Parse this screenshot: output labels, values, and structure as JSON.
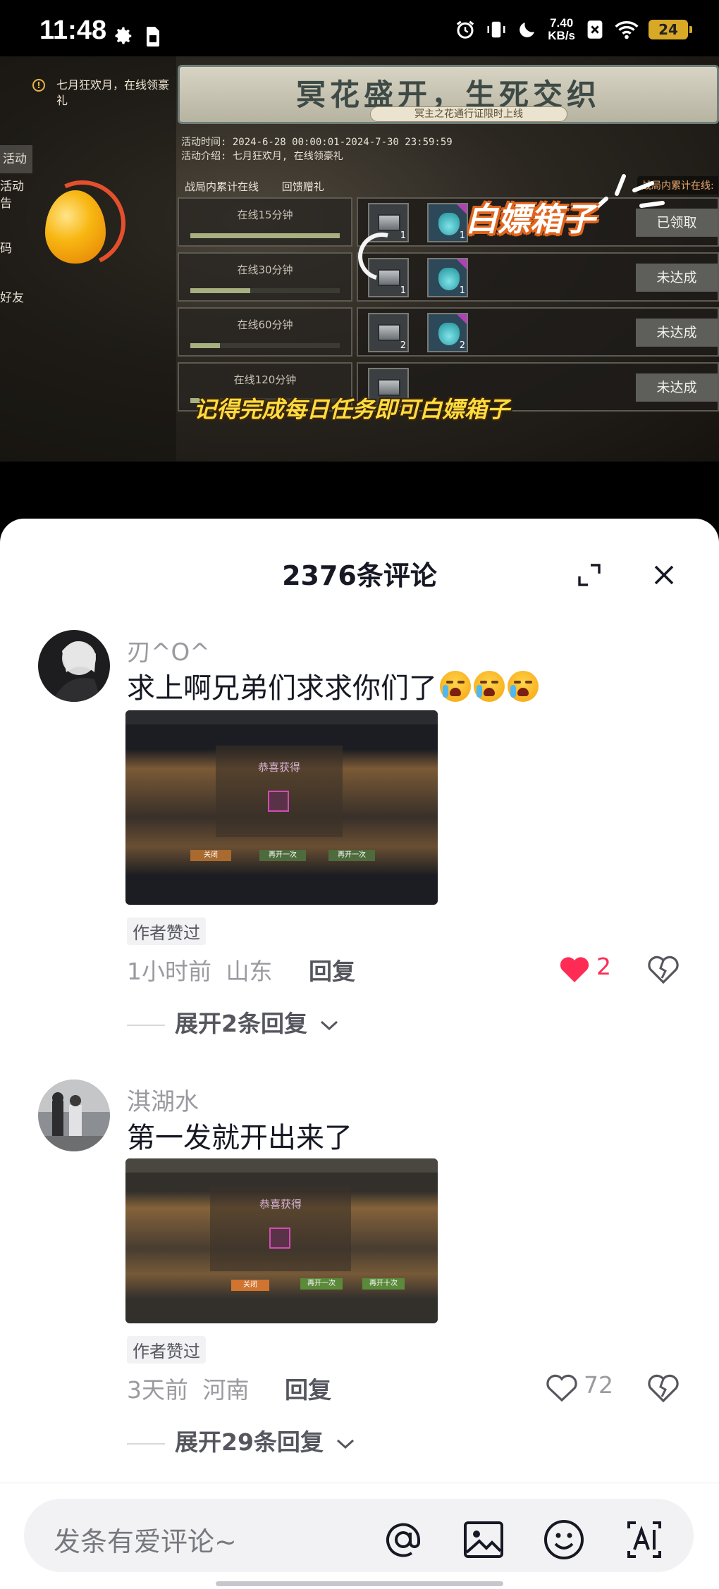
{
  "status_bar": {
    "time": "11:48",
    "net_speed_value": "7.40",
    "net_speed_unit": "KB/s",
    "battery": "24"
  },
  "video": {
    "notice": "七月狂欢月，在线领豪礼",
    "side_menu": [
      "活动",
      "活动",
      "告",
      "码",
      "好友"
    ],
    "banner_title": "冥花盛开，生死交织",
    "banner_subtitle": "冥主之花通行证限时上线",
    "activity_time": "活动时间: 2024-6-28 00:00:01-2024-7-30 23:59:59",
    "activity_intro": "活动介绍: 七月狂欢月, 在线领豪礼",
    "tabs": [
      "战局内累计在线",
      "回馈赠礼"
    ],
    "tab_right": "战局内累计在线:",
    "rows": [
      {
        "label": "在线15分钟",
        "progress": 1.0,
        "box_count": "1",
        "bag_count": "1",
        "status": "已领取"
      },
      {
        "label": "在线30分钟",
        "progress": 0.4,
        "box_count": "1",
        "bag_count": "1",
        "status": "未达成"
      },
      {
        "label": "在线60分钟",
        "progress": 0.2,
        "box_count": "2",
        "bag_count": "2",
        "status": "未达成"
      },
      {
        "label": "在线120分钟",
        "progress": 0.1,
        "box_count": "",
        "bag_count": "",
        "status": "未达成"
      }
    ],
    "sticker_top": "白嫖箱子",
    "sticker_bottom": "记得完成每日任务即可白嫖箱子"
  },
  "comments_header": {
    "title": "2376条评论"
  },
  "comments": [
    {
      "user": "刃^O^",
      "text": "求上啊兄弟们求求你们了",
      "image_popup_title": "恭喜获得",
      "image_buttons": [
        "关闭",
        "再开一次",
        "再开一次"
      ],
      "badge": "作者赞过",
      "time": "1小时前",
      "location": "山东",
      "reply": "回复",
      "likes": "2",
      "liked": true,
      "expand": "展开2条回复"
    },
    {
      "user": "淇湖水",
      "text": "第一发就开出来了",
      "image_popup_title": "恭喜获得",
      "image_buttons": [
        "关闭",
        "再开一次",
        "再开十次"
      ],
      "badge": "作者赞过",
      "time": "3天前",
      "location": "河南",
      "reply": "回复",
      "likes": "72",
      "liked": false,
      "expand": "展开29条回复"
    }
  ],
  "input": {
    "placeholder": "发条有爱评论~"
  },
  "colors": {
    "like_active": "#fe2c55",
    "text_primary": "#161823",
    "text_secondary": "#9a9aa0"
  }
}
